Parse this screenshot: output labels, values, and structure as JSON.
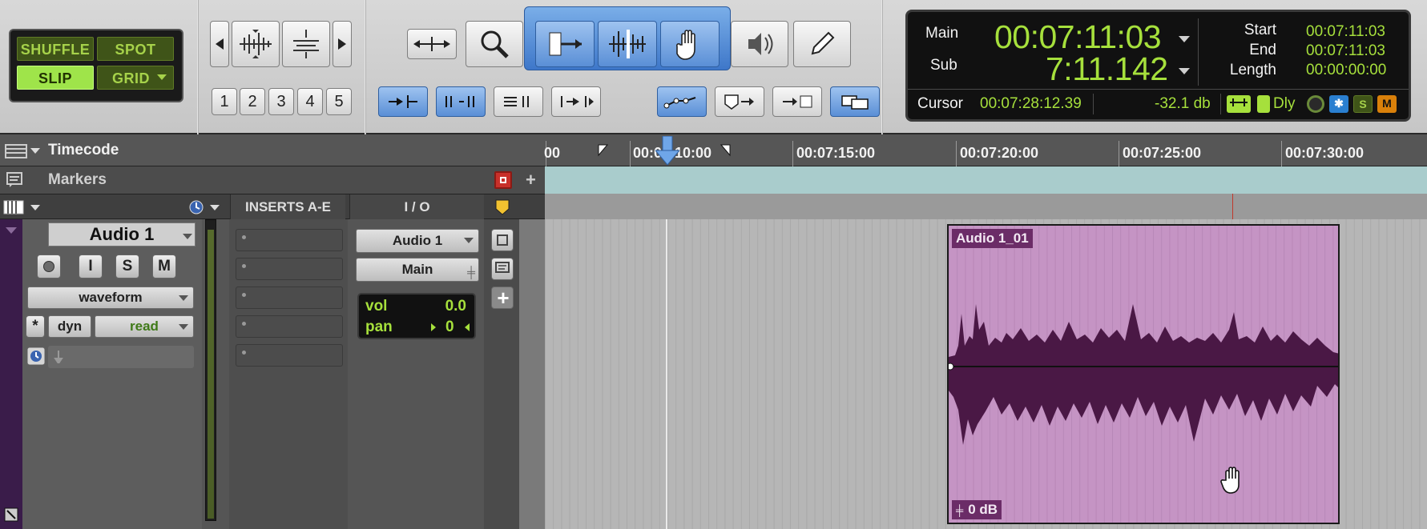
{
  "edit_modes": {
    "shuffle": "SHUFFLE",
    "spot": "SPOT",
    "slip": "SLIP",
    "grid": "GRID"
  },
  "zoom_presets": [
    "1",
    "2",
    "3",
    "4",
    "5"
  ],
  "counter": {
    "main_label": "Main",
    "main_value": "00:07:11:03",
    "sub_label": "Sub",
    "sub_value": "7:11.142",
    "start_label": "Start",
    "start_value": "00:07:11:03",
    "end_label": "End",
    "end_value": "00:07:11:03",
    "length_label": "Length",
    "length_value": "00:00:00:00",
    "cursor_label": "Cursor",
    "cursor_value": "00:07:28:12.39",
    "level_value": "-32.1 db",
    "dly_label": "Dly",
    "s_label": "S",
    "m_label": "M"
  },
  "ruler": {
    "title": "Timecode",
    "ticks": [
      "00",
      "00:07:10:00",
      "00:07:15:00",
      "00:07:20:00",
      "00:07:25:00",
      "00:07:30:00"
    ]
  },
  "markers": {
    "title": "Markers"
  },
  "columns": {
    "inserts": "INSERTS A-E",
    "io": "I / O"
  },
  "track": {
    "name": "Audio 1",
    "rec": "",
    "input": "I",
    "solo": "S",
    "mute": "M",
    "view": "waveform",
    "auto_mode_label": "dyn",
    "auto_mode": "read",
    "io_input": "Audio 1",
    "io_output": "Main",
    "vol_label": "vol",
    "vol_value": "0.0",
    "pan_label": "pan",
    "pan_value": "0"
  },
  "clip": {
    "name": "Audio 1_01",
    "gain": "0 dB"
  },
  "colors": {
    "counter_green": "#a6e03c",
    "clip": "#c594c4",
    "clip_label": "#6b2c67",
    "tool_blue": "#5a8fd6",
    "markers_lane": "#a9cccc"
  }
}
